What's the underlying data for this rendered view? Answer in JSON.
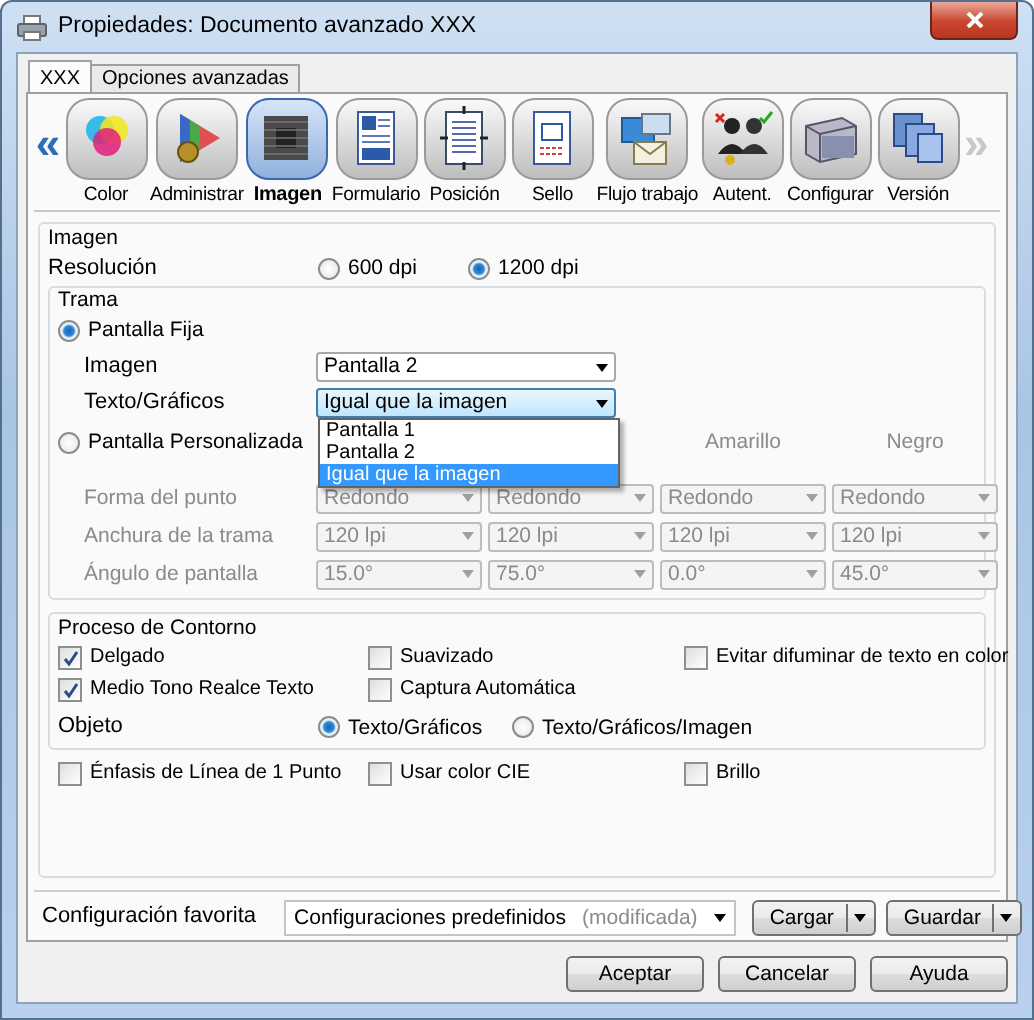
{
  "window": {
    "title": "Propiedades: Documento avanzado XXX"
  },
  "tabs": [
    {
      "label": "XXX",
      "selected": true
    },
    {
      "label": "Opciones avanzadas",
      "selected": false
    }
  ],
  "toolbar": {
    "prev": {
      "label": "«",
      "disabled": false
    },
    "next": {
      "label": "»",
      "disabled": true
    },
    "items": [
      {
        "label": "Color",
        "selected": false
      },
      {
        "label": "Administrar",
        "selected": false
      },
      {
        "label": "Imagen",
        "selected": true
      },
      {
        "label": "Formulario",
        "selected": false
      },
      {
        "label": "Posición",
        "selected": false
      },
      {
        "label": "Sello",
        "selected": false
      },
      {
        "label": "Flujo trabajo",
        "selected": false
      },
      {
        "label": "Autent.",
        "selected": false
      },
      {
        "label": "Configurar",
        "selected": false
      },
      {
        "label": "Versión",
        "selected": false
      }
    ]
  },
  "image": {
    "title": "Imagen",
    "resolution": {
      "label": "Resolución",
      "options": [
        {
          "label": "600 dpi",
          "selected": false
        },
        {
          "label": "1200 dpi",
          "selected": true
        }
      ]
    },
    "screen": {
      "title": "Trama",
      "fixed": {
        "label": "Pantalla Fija",
        "selected": true,
        "fields": [
          {
            "label": "Imagen",
            "value": "Pantalla 2",
            "focused": false
          },
          {
            "label": "Texto/Gráficos",
            "value": "Igual que la imagen",
            "focused": true
          }
        ]
      },
      "dropdown_list": [
        {
          "label": "Pantalla 1",
          "selected": false
        },
        {
          "label": "Pantalla 2",
          "selected": false
        },
        {
          "label": "Igual que la imagen",
          "selected": true
        }
      ],
      "custom": {
        "label": "Pantalla Personalizada",
        "selected": false,
        "disabled": true,
        "visible_headers": [
          "Amarillo",
          "Negro"
        ],
        "rows": [
          {
            "label": "Forma del punto",
            "values": [
              "Redondo",
              "Redondo",
              "Redondo",
              "Redondo"
            ]
          },
          {
            "label": "Anchura de la trama",
            "values": [
              "120 lpi",
              "120 lpi",
              "120 lpi",
              "120 lpi"
            ]
          },
          {
            "label": "Ángulo de pantalla",
            "values": [
              "15.0°",
              "75.0°",
              "0.0°",
              "45.0°"
            ]
          }
        ]
      }
    },
    "contour": {
      "title": "Proceso de Contorno",
      "options": [
        {
          "label": "Delgado",
          "checked": true
        },
        {
          "label": "Suavizado",
          "checked": false
        },
        {
          "label": "Evitar difuminar de texto en color",
          "checked": false
        },
        {
          "label": "Medio Tono Realce Texto",
          "checked": true
        },
        {
          "label": "Captura Automática",
          "checked": false
        }
      ],
      "object": {
        "label": "Objeto",
        "options": [
          {
            "label": "Texto/Gráficos",
            "selected": true
          },
          {
            "label": "Texto/Gráficos/Imagen",
            "selected": false
          }
        ]
      }
    },
    "extras": [
      {
        "label": "Énfasis de Línea de 1 Punto",
        "checked": false
      },
      {
        "label": "Usar color CIE",
        "checked": false
      },
      {
        "label": "Brillo",
        "checked": false
      }
    ]
  },
  "favorite": {
    "label": "Configuración favorita",
    "value": "Configuraciones predefinidos",
    "note": "(modificada)",
    "buttons": [
      "Cargar",
      "Guardar"
    ]
  },
  "buttons": [
    "Aceptar",
    "Cancelar",
    "Ayuda"
  ]
}
